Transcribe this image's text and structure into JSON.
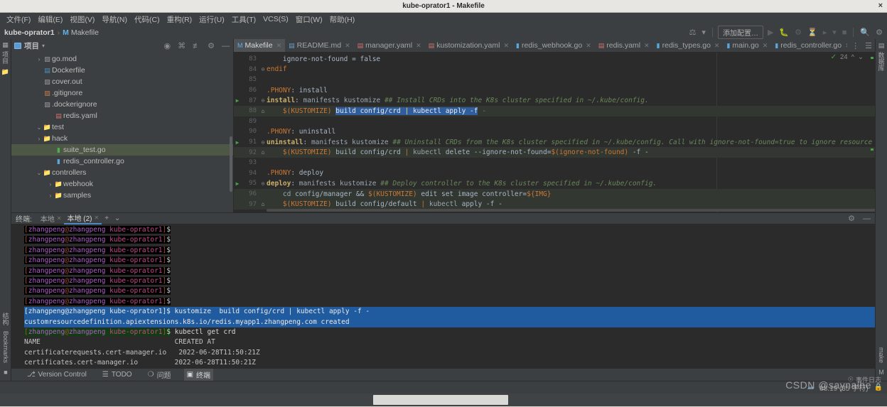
{
  "window": {
    "title": "kube-oprator1 - Makefile",
    "close_label": "×"
  },
  "menubar": {
    "items": [
      "文件(F)",
      "编辑(E)",
      "视图(V)",
      "导航(N)",
      "代码(C)",
      "重构(R)",
      "运行(U)",
      "工具(T)",
      "VCS(S)",
      "窗口(W)",
      "帮助(H)"
    ]
  },
  "breadcrumb": {
    "project": "kube-oprator1",
    "separator": "›",
    "file_badge": "M",
    "file": "Makefile"
  },
  "main_toolbar": {
    "run_config_label": "添加配置…",
    "icons": [
      "build-icon",
      "run-icon",
      "debug-icon",
      "coverage-icon",
      "profile-icon",
      "run-with-icon",
      "stop-icon",
      "search-icon",
      "settings-icon"
    ]
  },
  "left_rail": {
    "top_label": "项目",
    "bottom_labels": [
      "结构",
      "Bookmarks"
    ]
  },
  "right_rail": {
    "top_label": "数据库",
    "bottom_label": "make"
  },
  "project_panel": {
    "title": "项目",
    "dropdown": "▾",
    "header_icons": [
      "locate-icon",
      "collapse-all-icon",
      "expand-icon",
      "gear-icon",
      "hide-icon"
    ],
    "tree": [
      {
        "indent": 2,
        "arrow": "›",
        "icon": "folder",
        "label": "samples",
        "selected": false
      },
      {
        "indent": 2,
        "arrow": "›",
        "icon": "folder",
        "label": "webhook",
        "selected": false
      },
      {
        "indent": 1,
        "arrow": "⌄",
        "icon": "folder",
        "label": "controllers",
        "selected": false
      },
      {
        "indent": 2,
        "arrow": "",
        "icon": "go",
        "label": "redis_controller.go",
        "selected": false
      },
      {
        "indent": 2,
        "arrow": "",
        "icon": "gotest",
        "label": "suite_test.go",
        "selected": true
      },
      {
        "indent": 1,
        "arrow": "›",
        "icon": "folder",
        "label": "hack",
        "selected": false
      },
      {
        "indent": 1,
        "arrow": "⌄",
        "icon": "folder",
        "label": "test",
        "selected": false
      },
      {
        "indent": 2,
        "arrow": "",
        "icon": "yaml",
        "label": "redis.yaml",
        "selected": false
      },
      {
        "indent": 1,
        "arrow": "",
        "icon": "file",
        "label": ".dockerignore",
        "selected": false
      },
      {
        "indent": 1,
        "arrow": "",
        "icon": "git",
        "label": ".gitignore",
        "selected": false
      },
      {
        "indent": 1,
        "arrow": "",
        "icon": "file",
        "label": "cover.out",
        "selected": false
      },
      {
        "indent": 1,
        "arrow": "",
        "icon": "docker",
        "label": "Dockerfile",
        "selected": false
      },
      {
        "indent": 1,
        "arrow": "›",
        "icon": "file",
        "label": "go.mod",
        "selected": false
      }
    ]
  },
  "editor": {
    "tabs": [
      {
        "label": "redis_controller.go",
        "icon": "go-file-icon",
        "active": false,
        "closable": true
      },
      {
        "label": "main.go",
        "icon": "go-file-icon",
        "active": false,
        "closable": true
      },
      {
        "label": "redis_types.go",
        "icon": "go-file-icon",
        "active": false,
        "closable": true
      },
      {
        "label": "redis.yaml",
        "icon": "yaml-file-icon",
        "active": false,
        "closable": true
      },
      {
        "label": "redis_webhook.go",
        "icon": "go-file-icon",
        "active": false,
        "closable": true
      },
      {
        "label": "kustomization.yaml",
        "icon": "yaml-file-icon",
        "active": false,
        "closable": true
      },
      {
        "label": "manager.yaml",
        "icon": "yaml-file-icon",
        "active": false,
        "closable": true
      },
      {
        "label": "README.md",
        "icon": "md-file-icon",
        "active": false,
        "closable": true
      },
      {
        "label": "Makefile",
        "icon": "makefile-icon",
        "active": true,
        "closable": true
      }
    ],
    "inspection_count": "24",
    "inspection_state": "ok",
    "code": [
      {
        "n": "83",
        "gutter": "",
        "fold": "",
        "hl": false,
        "text": "    ignore-not-found = false"
      },
      {
        "n": "84",
        "gutter": "",
        "fold": "⊖",
        "hl": false,
        "text": "endif"
      },
      {
        "n": "85",
        "gutter": "",
        "fold": "",
        "hl": false,
        "text": ""
      },
      {
        "n": "86",
        "gutter": "",
        "fold": "",
        "hl": false,
        "text": ".PHONY: install"
      },
      {
        "n": "87",
        "gutter": "▶",
        "fold": "⊖",
        "hl": false,
        "text": "install: manifests kustomize ## Install CRDs into the K8s cluster specified in ~/.kube/config."
      },
      {
        "n": "88",
        "gutter": "",
        "fold": "⌂",
        "hl": true,
        "text": "\t$(KUSTOMIZE) build config/crd | kubectl apply -f -"
      },
      {
        "n": "89",
        "gutter": "",
        "fold": "",
        "hl": false,
        "text": ""
      },
      {
        "n": "90",
        "gutter": "",
        "fold": "",
        "hl": false,
        "text": ".PHONY: uninstall"
      },
      {
        "n": "91",
        "gutter": "▶",
        "fold": "⊖",
        "hl": false,
        "text": "uninstall: manifests kustomize ## Uninstall CRDs from the K8s cluster specified in ~/.kube/config. Call with ignore-not-found=true to ignore resource not found err"
      },
      {
        "n": "92",
        "gutter": "",
        "fold": "⌂",
        "hl": true,
        "text": "\t$(KUSTOMIZE) build config/crd | kubectl delete --ignore-not-found=$(ignore-not-found) -f -"
      },
      {
        "n": "93",
        "gutter": "",
        "fold": "",
        "hl": false,
        "text": ""
      },
      {
        "n": "94",
        "gutter": "",
        "fold": "",
        "hl": false,
        "text": ".PHONY: deploy"
      },
      {
        "n": "95",
        "gutter": "▶",
        "fold": "⊖",
        "hl": false,
        "text": "deploy: manifests kustomize ## Deploy controller to the K8s cluster specified in ~/.kube/config."
      },
      {
        "n": "96",
        "gutter": "",
        "fold": "",
        "hl": true,
        "text": "\tcd config/manager && $(KUSTOMIZE) edit set image controller=${IMG}"
      },
      {
        "n": "97",
        "gutter": "",
        "fold": "⌂",
        "hl": true,
        "text": "\t$(KUSTOMIZE) build config/default | kubectl apply -f -"
      }
    ]
  },
  "terminal": {
    "label": "终端:",
    "tabs": [
      {
        "label": "本地",
        "active": false
      },
      {
        "label": "本地 (2)",
        "active": true
      }
    ],
    "add_label": "+",
    "dropdown_label": "⌄",
    "header_icons": [
      "gear-icon",
      "hide-icon"
    ],
    "prompt": "[zhangpeng@zhangpeng kube-oprator1]$",
    "lines": [
      {
        "type": "prompt",
        "cmd": ""
      },
      {
        "type": "prompt",
        "cmd": ""
      },
      {
        "type": "prompt",
        "cmd": ""
      },
      {
        "type": "prompt",
        "cmd": ""
      },
      {
        "type": "prompt",
        "cmd": ""
      },
      {
        "type": "prompt",
        "cmd": ""
      },
      {
        "type": "prompt",
        "cmd": ""
      },
      {
        "type": "prompt",
        "cmd": ""
      },
      {
        "type": "prompt-sel",
        "cmd": " kustomize  build config/crd | kubectl apply -f -"
      },
      {
        "type": "output-sel",
        "text": "customresourcedefinition.apiextensions.k8s.io/redis.myapp1.zhangpeng.com created"
      },
      {
        "type": "prompt-green",
        "cmd": " kubectl get crd"
      },
      {
        "type": "output",
        "text": "NAME                                 CREATED AT"
      },
      {
        "type": "output",
        "text": "certificaterequests.cert-manager.io   2022-06-28T11:50:21Z"
      },
      {
        "type": "output",
        "text": "certificates.cert-manager.io         2022-06-28T11:50:21Z"
      }
    ]
  },
  "tool_window_bar": {
    "items": [
      {
        "label": "Version Control",
        "icon": "branch-icon",
        "active": false
      },
      {
        "label": "TODO",
        "icon": "todo-icon",
        "active": false
      },
      {
        "label": "问题",
        "icon": "problems-icon",
        "active": false
      },
      {
        "label": "终端",
        "icon": "terminal-icon",
        "active": true
      }
    ]
  },
  "statusbar": {
    "caret": "88:19 (35 字符)",
    "event_log": "事件日志",
    "watermark": "CSDN @saynaihe"
  }
}
